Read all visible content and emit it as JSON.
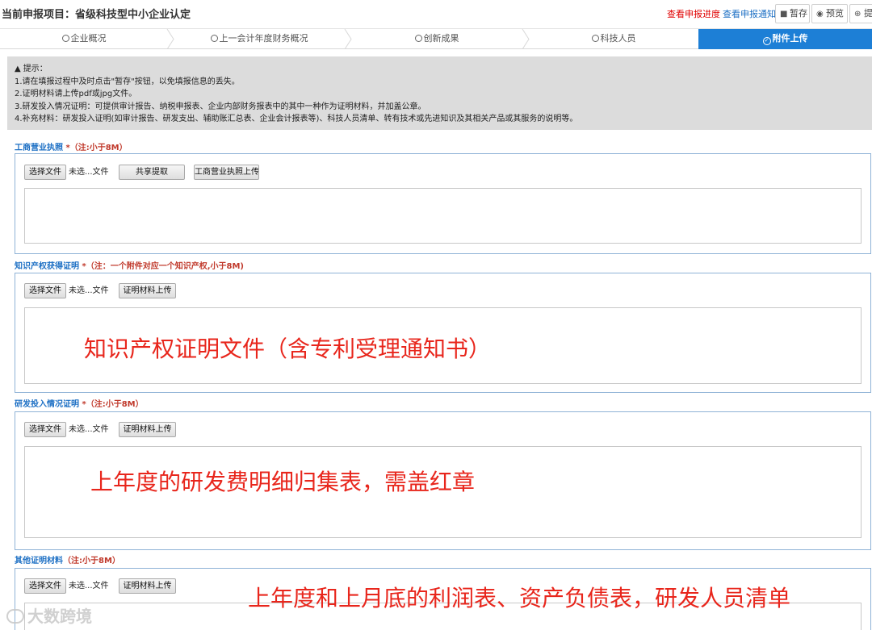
{
  "header": {
    "project_title": "当前申报项目：省级科技型中小企业认定",
    "link_progress": "查看申报进度",
    "link_notice": "查看申报通知",
    "btn_save": "暂存",
    "btn_preview": "预览",
    "btn_submit": "提"
  },
  "steps": [
    {
      "label": "企业概况",
      "active": false
    },
    {
      "label": "上一会计年度财务概况",
      "active": false
    },
    {
      "label": "创新成果",
      "active": false
    },
    {
      "label": "科技人员",
      "active": false
    },
    {
      "label": "附件上传",
      "active": true
    }
  ],
  "notice": {
    "title": "提示：",
    "lines": [
      "1.请在填报过程中及时点击\"暂存\"按钮，以免填报信息的丢失。",
      "2.证明材料请上传pdf或jpg文件。",
      "3.研发投入情况证明：可提供审计报告、纳税申报表、企业内部财务报表中的其中一种作为证明材料，并加盖公章。",
      "4.补充材料：研发投入证明(如审计报告、研发支出、辅助账汇总表、企业会计报表等)、科技人员清单、转有技术或先进知识及其相关产品或其服务的说明等。"
    ]
  },
  "sections": [
    {
      "label": "工商营业执照",
      "required_mark": "*",
      "note": "（注:小于8M）",
      "choose_label": "选择文件",
      "file_state": "未选...文件",
      "extra_button": "共享提取",
      "upload_button": "工商营业执照上传",
      "overlay": ""
    },
    {
      "label": "知识产权获得证明",
      "required_mark": "*",
      "note": "（注：一个附件对应一个知识产权,小于8M)",
      "choose_label": "选择文件",
      "file_state": "未选...文件",
      "upload_button": "证明材料上传",
      "overlay": "知识产权证明文件（含专利受理通知书）"
    },
    {
      "label": "研发投入情况证明",
      "required_mark": "*",
      "note": "（注:小于8M）",
      "choose_label": "选择文件",
      "file_state": "未选...文件",
      "upload_button": "证明材料上传",
      "overlay": "上年度的研发费明细归集表，需盖红章"
    },
    {
      "label": "其他证明材料",
      "required_mark": "",
      "note": "（注:小于8M）",
      "choose_label": "选择文件",
      "file_state": "未选...文件",
      "upload_button": "证明材料上传",
      "overlay": "上年度和上月底的利润表、资产负债表，研发人员清单"
    }
  ],
  "watermark": "大数跨境",
  "colors": {
    "accent": "#1d7fd6",
    "link_red": "#e00000",
    "label_blue": "#1c6fc4",
    "overlay_red": "#e8261c",
    "notice_bg": "#dcdcdc"
  }
}
